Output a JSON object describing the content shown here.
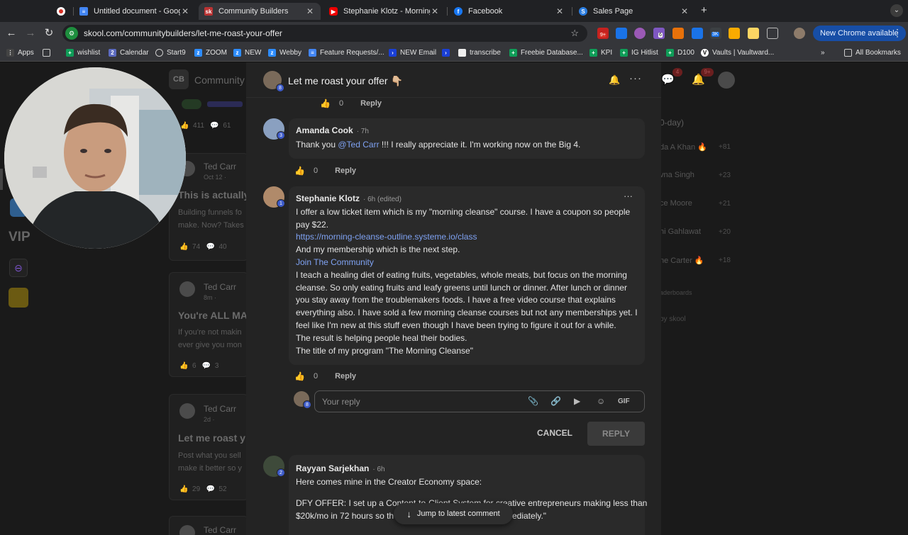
{
  "browser": {
    "tabs": [
      {
        "title": "",
        "active": false
      },
      {
        "title": "Untitled document - Google D",
        "active": false
      },
      {
        "title": "Community Builders",
        "active": true
      },
      {
        "title": "Stephanie Klotz - Morning Cle",
        "active": false
      },
      {
        "title": "Facebook",
        "active": false
      },
      {
        "title": "Sales Page",
        "active": false
      }
    ],
    "url": "skool.com/communitybuilders/let-me-roast-your-offer",
    "new_chrome": "New Chrome available",
    "ext_badges": [
      "9+",
      "6",
      "3K"
    ],
    "bookmarks": [
      "Apps",
      "wishlist",
      "Calendar",
      "Start9",
      "ZOOM",
      "NEW",
      "Webby",
      "Feature Requests/...",
      "NEW Email",
      "transcribe",
      "Freebie Database...",
      "KPI",
      "IG Hitlist",
      "D100",
      "Vaults | Vaultward..."
    ],
    "all_bookmarks": "All Bookmarks"
  },
  "background": {
    "community_letters": "CB",
    "community_name": "Community",
    "feed": [
      {
        "author": "Ted Carr",
        "meta": "Oct 12 ·",
        "title": "This is actually",
        "body1": "Building funnels fo",
        "body2": "make. Now? Takes",
        "likes": "74",
        "comments": "40"
      },
      {
        "author": "Ted Carr",
        "meta": "8m ·",
        "title": "You're ALL MA",
        "body1": "If you're not makin",
        "body2": "ever give you mon",
        "likes": "6",
        "comments": "3"
      },
      {
        "author": "Ted Carr",
        "meta": "2d ·",
        "title": "Let me roast y",
        "body1": "Post what you sell",
        "body2": "make it better so y",
        "likes": "29",
        "comments": "52"
      },
      {
        "author": "Ted Carr",
        "meta": "",
        "title": "",
        "body1": "",
        "body2": "",
        "likes": "",
        "comments": ""
      }
    ],
    "top_counts": {
      "likes": "411",
      "comments": "61"
    },
    "leaderboard_title": "0-day)",
    "leaderboard": [
      {
        "name": "da A Khan 🔥",
        "points": "+81"
      },
      {
        "name": "vna Singh",
        "points": "+23"
      },
      {
        "name": "ce Moore",
        "points": "+21"
      },
      {
        "name": "hi Gahlawat",
        "points": "+20"
      },
      {
        "name": "ne Carter 🔥",
        "points": "+18"
      }
    ],
    "leaderboards_link": "aderboards",
    "powered": "by skool",
    "notif_badges": [
      "4",
      "9+"
    ],
    "vip": "VIP"
  },
  "modal": {
    "title": "Let me roast your offer 👇🏼",
    "op_level": "8",
    "top_likes": "0",
    "reply_label": "Reply",
    "comments": [
      {
        "author": "Amanda Cook",
        "time": "· 7h",
        "level": "3",
        "mention": "@Ted Carr",
        "text_before": "Thank you ",
        "text_after": " !!! I really appreciate it. I'm working now on the Big 4.",
        "likes": "0"
      },
      {
        "author": "Stephanie Klotz",
        "time": "· 6h (edited)",
        "level": "1",
        "lines": [
          {
            "text": "I offer a low ticket item which is my \"morning cleanse\" course. I have a coupon so people",
            "link": false
          },
          {
            "text": "pay $22.",
            "link": false
          },
          {
            "text": "https://morning-cleanse-outline.systeme.io/class",
            "link": true
          },
          {
            "text": "And my membership which is the next step.",
            "link": false
          },
          {
            "text": "Join The Community",
            "link": true
          },
          {
            "text": "I teach a healing diet of eating fruits, vegetables, whole meats, but focus on the morning",
            "link": false
          },
          {
            "text": "cleanse. So only eating fruits and leafy greens until lunch or dinner. After lunch or dinner",
            "link": false
          },
          {
            "text": "you stay away from the troublemakers foods. I have a free video course that explains",
            "link": false
          },
          {
            "text": "everything also. I have sold a few morning cleanse courses but not any memberships yet. I",
            "link": false
          },
          {
            "text": "feel like I'm new at this stuff even though I have been trying to figure it out for a while.",
            "link": false
          },
          {
            "text": "The result is helping people heal their bodies.",
            "link": false
          },
          {
            "text": "The title of my program \"The Morning Cleanse\"",
            "link": false
          }
        ],
        "likes": "0"
      },
      {
        "author": "Rayyan Sarjekhan",
        "time": "· 6h",
        "level": "2",
        "lines": [
          {
            "text": "Here comes mine in the Creator Economy space:"
          },
          {
            "text": "DFY OFFER: I set up a Content-to-Client System for creative entrepreneurs making less than"
          },
          {
            "text": "$20k/mo in 72 hours so th"
          },
          {
            "text": "mediately.\""
          }
        ]
      }
    ],
    "reply_input": {
      "placeholder": "Your reply",
      "level": "8"
    },
    "gif": "GIF",
    "cancel": "CANCEL",
    "reply_button": "REPLY",
    "jump": "Jump to latest comment"
  }
}
